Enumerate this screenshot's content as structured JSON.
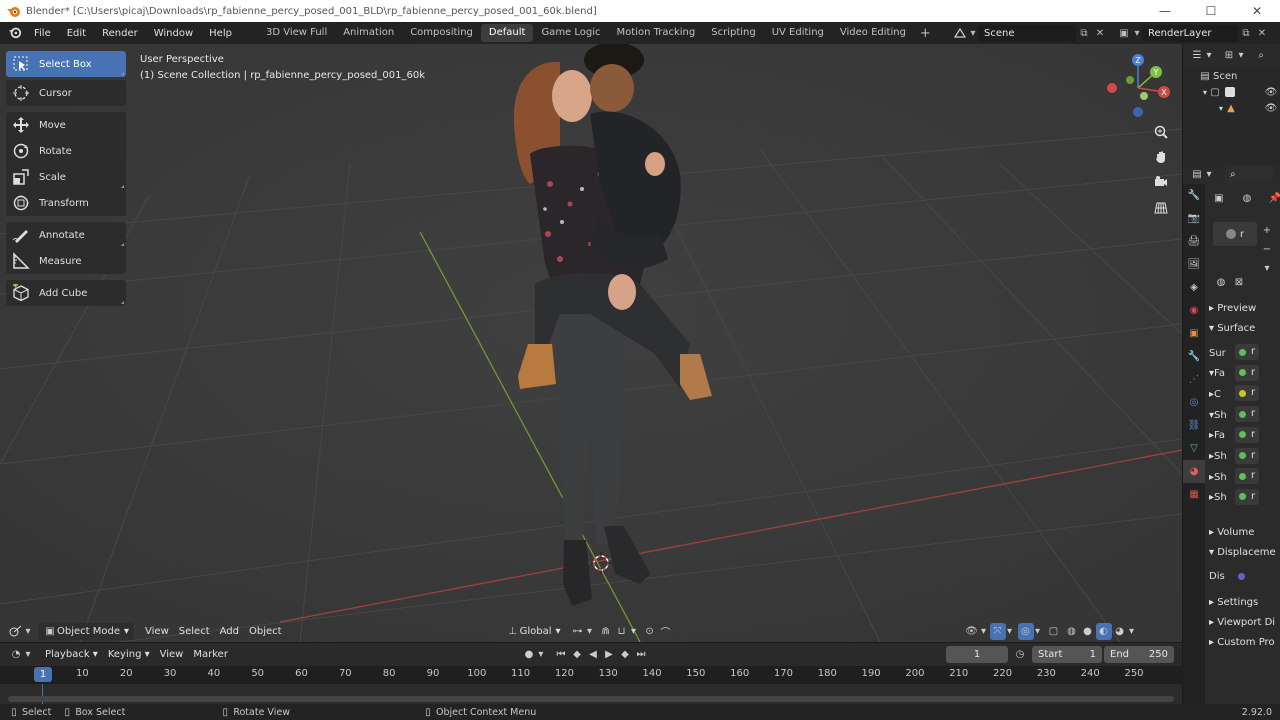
{
  "titlebar": {
    "title": "Blender* [C:\\Users\\picaj\\Downloads\\rp_fabienne_percy_posed_001_BLD\\rp_fabienne_percy_posed_001_60k.blend]",
    "minimize": "—",
    "maximize": "☐",
    "close": "✕"
  },
  "menu": {
    "items": [
      "File",
      "Edit",
      "Render",
      "Window",
      "Help"
    ]
  },
  "workspaces": {
    "tabs": [
      "3D View Full",
      "Animation",
      "Compositing",
      "Default",
      "Game Logic",
      "Motion Tracking",
      "Scripting",
      "UV Editing",
      "Video Editing"
    ],
    "active": "Default",
    "add": "+"
  },
  "scene": {
    "name": "Scene",
    "render_layer": "RenderLayer"
  },
  "viewport": {
    "perspective": "User Perspective",
    "collection": "(1) Scene Collection | rp_fabienne_percy_posed_001_60k"
  },
  "toolbar": {
    "tools": [
      {
        "label": "Select Box",
        "icon": "select-box-icon"
      },
      {
        "label": "Cursor",
        "icon": "cursor-icon"
      },
      {
        "label": "Move",
        "icon": "move-icon"
      },
      {
        "label": "Rotate",
        "icon": "rotate-icon"
      },
      {
        "label": "Scale",
        "icon": "scale-icon"
      },
      {
        "label": "Transform",
        "icon": "transform-icon"
      },
      {
        "label": "Annotate",
        "icon": "annotate-icon"
      },
      {
        "label": "Measure",
        "icon": "measure-icon"
      },
      {
        "label": "Add Cube",
        "icon": "add-cube-icon"
      }
    ]
  },
  "gizmo": {
    "x": "X",
    "y": "Y",
    "z": "Z"
  },
  "viewport_header": {
    "mode": "Object Mode",
    "menus": [
      "View",
      "Select",
      "Add",
      "Object"
    ],
    "orientation": "Global"
  },
  "timeline": {
    "menus": [
      "Playback",
      "Keying",
      "View",
      "Marker"
    ],
    "current_frame": "1",
    "start_label": "Start",
    "start": "1",
    "end_label": "End",
    "end": "250",
    "ticks": [
      "1",
      "10",
      "20",
      "30",
      "40",
      "50",
      "60",
      "70",
      "80",
      "90",
      "100",
      "110",
      "120",
      "130",
      "140",
      "150",
      "160",
      "170",
      "180",
      "190",
      "200",
      "210",
      "220",
      "230",
      "240",
      "250"
    ]
  },
  "statusbar": {
    "select": "Select",
    "box_select": "Box Select",
    "rotate_view": "Rotate View",
    "context_menu": "Object Context Menu",
    "version": "2.92.0"
  },
  "outliner": {
    "root": "Scen"
  },
  "properties": {
    "material_slot": "r",
    "sections": {
      "preview": "Preview",
      "surface": "Surface",
      "volume": "Volume",
      "displacement": "Displaceme",
      "settings": "Settings",
      "viewport_display": "Viewport Di",
      "custom_props": "Custom Pro"
    },
    "rows": [
      {
        "label": "Sur",
        "socket": "#5fbf5f",
        "value": "r"
      },
      {
        "label": "▾Fa",
        "socket": "#5fbf5f",
        "value": "r"
      },
      {
        "label": "▸C",
        "socket": "#c7c729",
        "value": "r"
      },
      {
        "label": "▾Sh",
        "socket": "#5fbf5f",
        "value": "r"
      },
      {
        "label": "▸Fa",
        "socket": "#5fbf5f",
        "value": "r"
      },
      {
        "label": "▸Sh",
        "socket": "#5fbf5f",
        "value": "r"
      },
      {
        "label": "▸Sh",
        "socket": "#5fbf5f",
        "value": "r"
      },
      {
        "label": "▸Sh",
        "socket": "#5fbf5f",
        "value": "r"
      }
    ],
    "disp_label": "Dis",
    "disp_socket": "#6363c7"
  },
  "colors": {
    "accent": "#4772b3",
    "axis_x": "#d14848",
    "axis_y": "#7fbf3f",
    "axis_z": "#4b7fd6"
  }
}
